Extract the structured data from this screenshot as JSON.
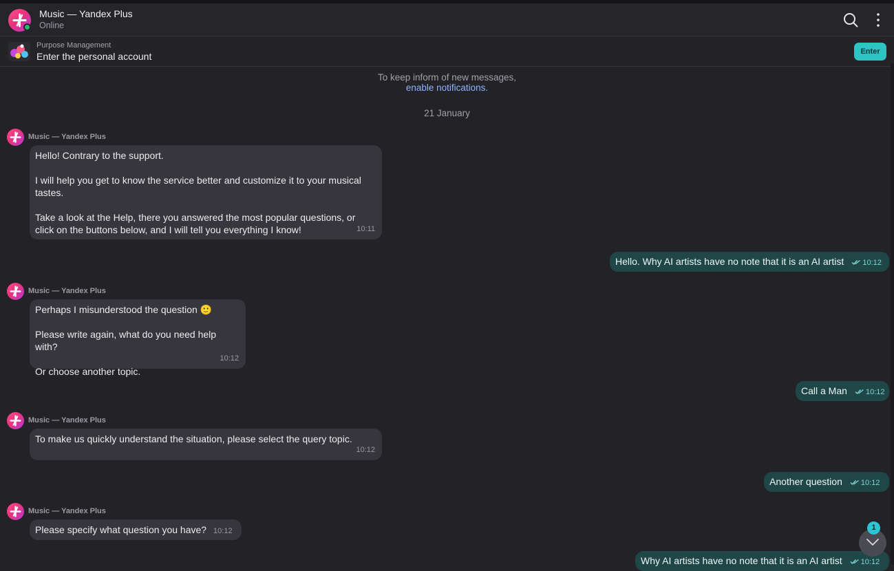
{
  "header": {
    "title": "Music — Yandex Plus",
    "status": "Online"
  },
  "pinned": {
    "caption": "Purpose Management",
    "text": "Enter the personal account",
    "button": "Enter"
  },
  "notice": {
    "line1": "To keep inform of new messages,",
    "link": "enable notifications."
  },
  "date_separator": "21 January",
  "messages": [
    {
      "sender": "Music — Yandex Plus",
      "text": "Hello! Contrary to the support.\n\nI will help you get to know the service better and customize it to your musical tastes.\n\nTake a look at the Help, there you answered the most popular questions, or click on the buttons below, and I will tell you everything I know!",
      "time": "10:11"
    },
    {
      "text": "Hello. Why AI artists have no note that it is an AI artist",
      "time": "10:12"
    },
    {
      "sender": "Music — Yandex Plus",
      "text": "Perhaps I misunderstood the question 🙂\n\nPlease write again, what do you need help with?\n\nOr choose another topic.",
      "time": "10:12"
    },
    {
      "text": "Call a Man",
      "time": "10:12"
    },
    {
      "sender": "Music — Yandex Plus",
      "text": "To make us quickly understand the situation, please select the query topic.",
      "time": "10:12"
    },
    {
      "text": "Another question",
      "time": "10:12"
    },
    {
      "sender": "Music — Yandex Plus",
      "text": "Please specify what question you have?",
      "time": "10:12"
    },
    {
      "text": "Why AI artists have no note that it is an AI artist",
      "time": "10:12"
    }
  ],
  "scroll": {
    "unread_count": "1"
  },
  "colors": {
    "accent": "#2fc4c4",
    "outgoing_bubble": "#1f4748",
    "incoming_bubble": "#36363c",
    "link": "#8fb4ff"
  },
  "icons": {
    "avatar": "yandex-plus-logo-icon",
    "search": "search-icon",
    "more": "more-vertical-icon",
    "scroll": "chevron-down-icon",
    "read": "double-check-icon"
  }
}
